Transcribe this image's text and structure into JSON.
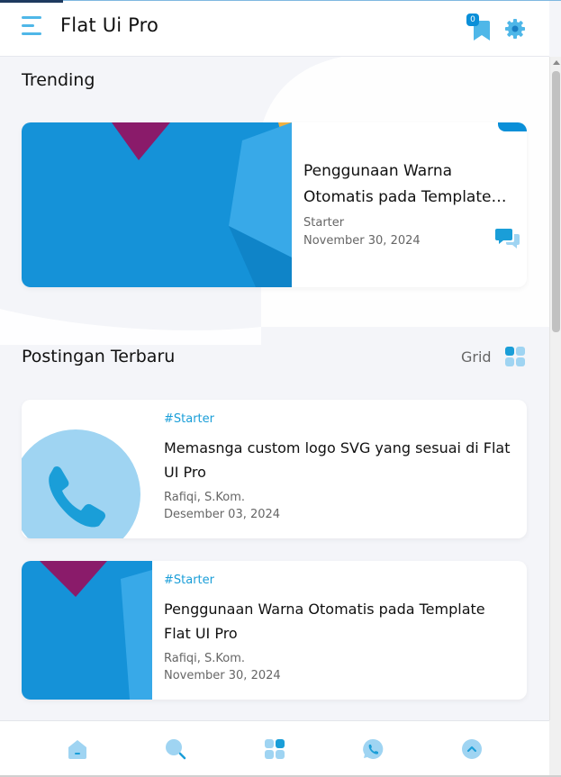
{
  "header": {
    "site_title": "Flat Ui Pro",
    "bookmark_count": "0",
    "menu_icon": "hamburger-icon",
    "bookmark_icon": "bookmark-icon",
    "settings_icon": "gear-icon"
  },
  "trending": {
    "heading": "Trending",
    "card": {
      "title": "Penggunaan Warna Otomatis pada Template Flat UI Pro",
      "category": "Starter",
      "date": "November 30, 2024",
      "comment_icon": "comments-icon"
    }
  },
  "latest": {
    "heading": "Postingan Terbaru",
    "view_label": "Grid",
    "posts": [
      {
        "tag": "#Starter",
        "title": "Memasnga custom logo SVG yang sesuai di Flat UI Pro",
        "author": "Rafiqi, S.Kom.",
        "date": "Desember 03, 2024",
        "thumb": "phone-thumbnail"
      },
      {
        "tag": "#Starter",
        "title": "Penggunaan Warna Otomatis pada Template Flat UI Pro",
        "author": "Rafiqi, S.Kom.",
        "date": "November 30, 2024",
        "thumb": "paper-thumbnail"
      }
    ]
  },
  "bottom_nav": {
    "items": [
      "home-icon",
      "search-icon",
      "grid-icon",
      "whatsapp-icon",
      "back-to-top-icon"
    ]
  },
  "colors": {
    "accent": "#0a8fd8",
    "accent_light": "#4fb7e8",
    "icon_light": "#9fd4f2",
    "text": "#111111",
    "muted": "#666666",
    "background": "#f4f5f9"
  }
}
